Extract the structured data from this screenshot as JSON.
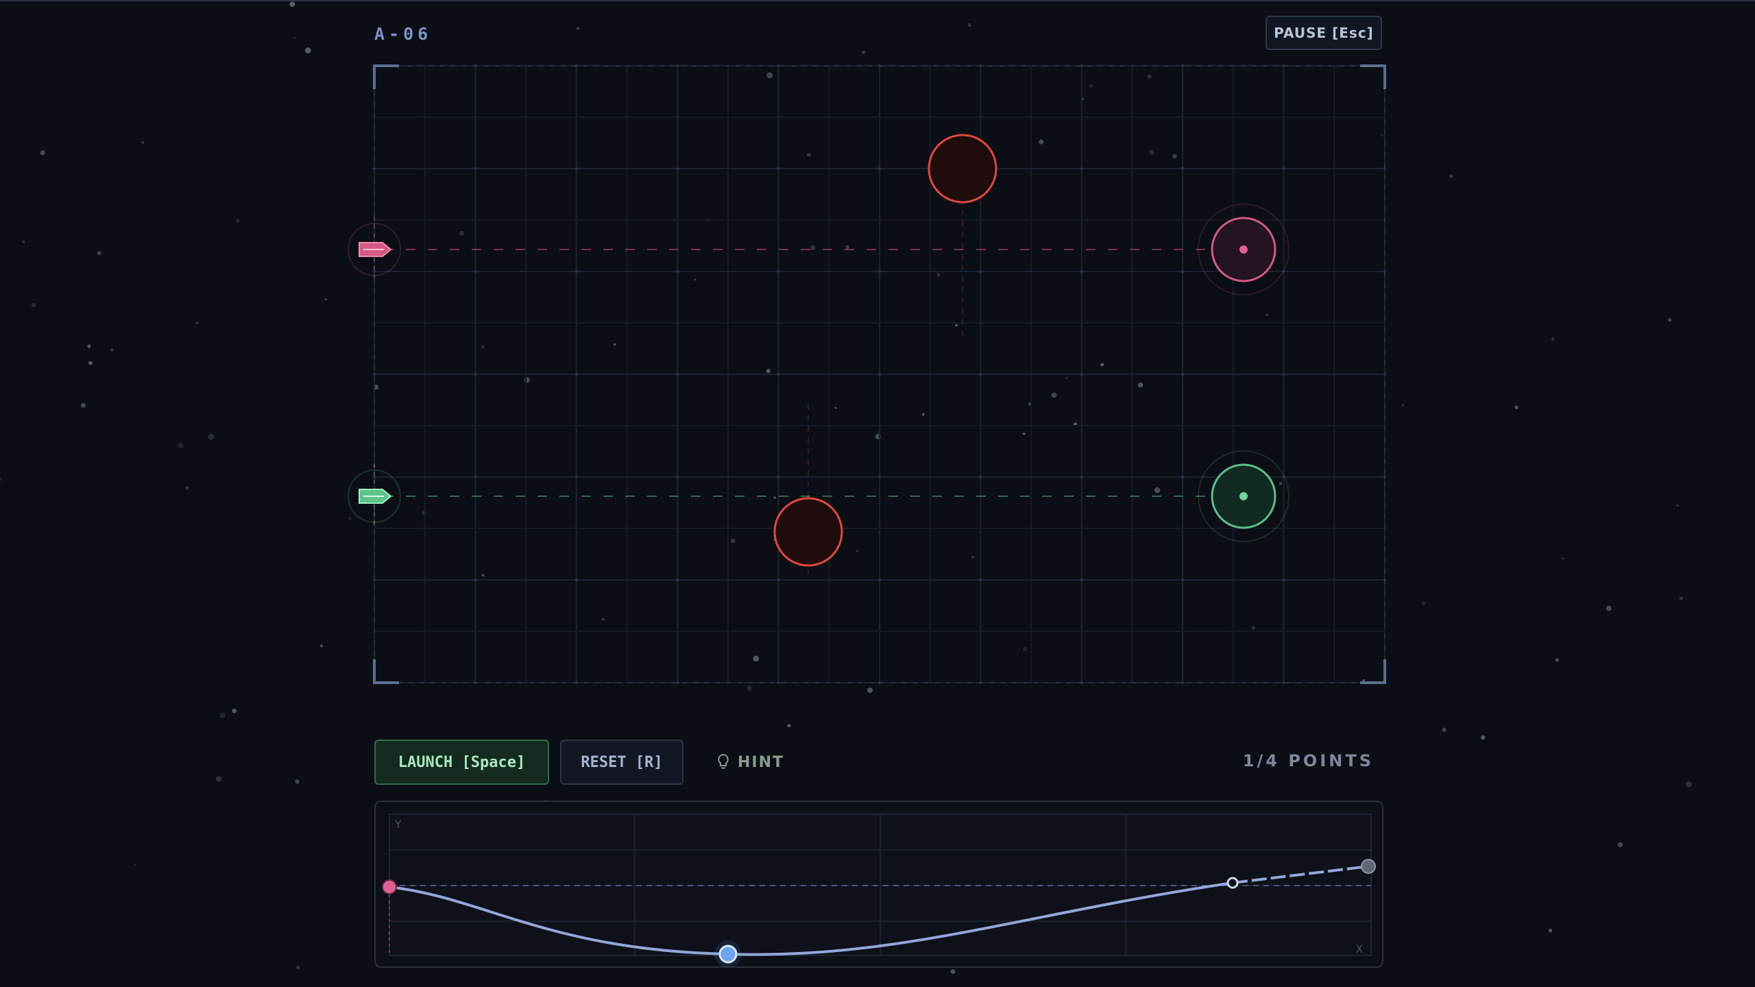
{
  "level": {
    "label": "A-06"
  },
  "controls": {
    "pause_label": "PAUSE [Esc]",
    "launch_label": "LAUNCH [Space]",
    "reset_label": "RESET [R]",
    "hint_label": "HINT"
  },
  "progress": {
    "points_label": "1/4 POINTS",
    "points_used": 1,
    "points_max": 4
  },
  "colors": {
    "background": "#0b0e14",
    "ship_pink": "#e0608f",
    "ship_green": "#6fd59c",
    "hazard": "#e0473e",
    "curve": "#94a6d8",
    "control_point": "#6ea4f0"
  },
  "graph": {
    "y_label": "Y",
    "x_label": "X"
  },
  "icons": {
    "hint": "lightbulb-icon",
    "ship": "ship-icon",
    "target": "target-icon",
    "hazard": "hazard-icon"
  }
}
